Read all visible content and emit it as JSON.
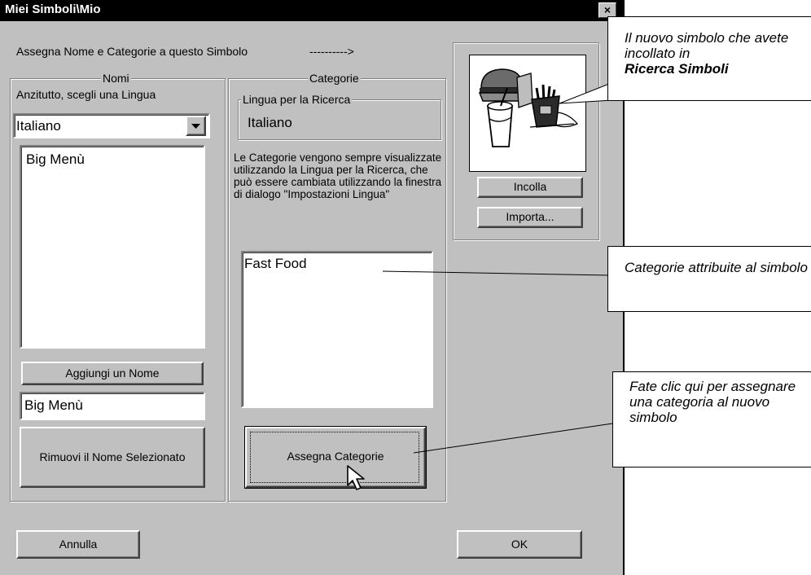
{
  "window": {
    "title": "Miei Simboli\\Mio",
    "close_glyph": "×"
  },
  "header": {
    "instruction": "Assegna Nome e Categorie a questo Simbolo",
    "arrow": "---------->"
  },
  "nomi": {
    "legend": "Nomi",
    "language_prompt": "Anzitutto, scegli una Lingua",
    "language_selected": "Italiano",
    "names_list": [
      "Big Menù"
    ],
    "add_button": "Aggiungi un Nome",
    "name_input_value": "Big Menù",
    "remove_button": "Rimuovi il Nome Selezionato"
  },
  "categorie": {
    "legend": "Categorie",
    "search_language_legend": "Lingua per la Ricerca",
    "search_language_value": "Italiano",
    "info_text": "Le Categorie vengono sempre visualizzate utilizzando la Lingua per la Ricerca, che può essere cambiata utilizzando la finestra di dialogo \"Impostazioni Lingua\"",
    "categories_list": [
      "Fast Food"
    ],
    "assign_button": "Assegna Categorie"
  },
  "symbol_panel": {
    "image_icon": "fast-food-symbol-icon",
    "paste_button": "Incolla",
    "import_button": "Importa..."
  },
  "footer": {
    "cancel_button": "Annulla",
    "ok_button": "OK"
  },
  "callouts": {
    "new_symbol": "Il nuovo simbolo che avete incollato in",
    "new_symbol_bold": "Ricerca Simboli",
    "categories": "Categorie attribuite al simbolo",
    "assign": "Fate clic qui per assegnare una categoria al nuovo simbolo"
  }
}
